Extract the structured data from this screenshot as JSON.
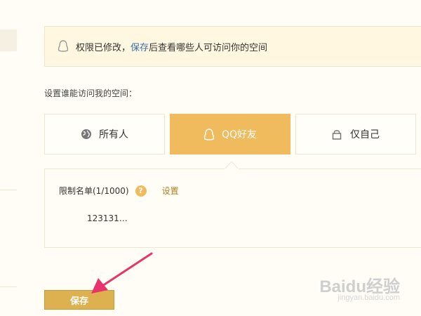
{
  "notice": {
    "prefix": "权限已修改，",
    "link": "保存",
    "suffix": "后查看哪些人可访问你的空间"
  },
  "access_label": "设置谁能访问我的空间：",
  "options": [
    {
      "label": "所有人",
      "icon": "globe-icon",
      "selected": false
    },
    {
      "label": "QQ好友",
      "icon": "qq-penguin-icon",
      "selected": true
    },
    {
      "label": "仅自己",
      "icon": "lock-icon",
      "selected": false
    }
  ],
  "restrict": {
    "label": "限制名单(1/1000)",
    "help": "?",
    "settings_link": "设置",
    "members": [
      "123131…"
    ]
  },
  "save_button": "保存",
  "watermark": {
    "brand": "Baidu经验",
    "url": "jingyan.baidu.com"
  },
  "colors": {
    "accent": "#efbb5c",
    "save_button": "#ddb050",
    "link": "#3a6ea5",
    "arrow": "#e8336d",
    "background": "#fffdf5"
  }
}
